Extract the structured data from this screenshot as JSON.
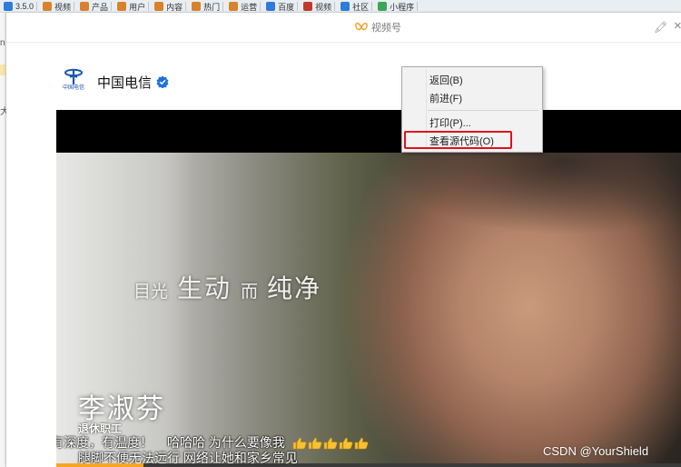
{
  "bookmarks": [
    {
      "label": "3.5.0",
      "color": "#2f7bd9"
    },
    {
      "label": "视频",
      "color": "#d9822b"
    },
    {
      "label": "产品",
      "color": "#d9822b"
    },
    {
      "label": "用户",
      "color": "#d9822b"
    },
    {
      "label": "内容",
      "color": "#d9822b"
    },
    {
      "label": "热门",
      "color": "#d9822b"
    },
    {
      "label": "运营",
      "color": "#d9822b"
    },
    {
      "label": "百度",
      "color": "#2f7bd9"
    },
    {
      "label": "视频",
      "color": "#c0392b"
    },
    {
      "label": "社区",
      "color": "#2f7bd9"
    },
    {
      "label": "小程序",
      "color": "#3aa757"
    }
  ],
  "window": {
    "title": "视频号",
    "pin_icon": "pin-icon",
    "close_icon": "close-icon"
  },
  "account": {
    "name": "中国电信",
    "logo_text": "中国电信",
    "verified_icon": "verified-badge-icon"
  },
  "video": {
    "subtitle": {
      "part1": "目光",
      "part2": "生动",
      "part3": "而",
      "part4": "纯净"
    },
    "person_name": "李淑芬",
    "person_title": "退休职工",
    "danmaku": {
      "line1a": "有深度，有温度！",
      "line1b": "哈哈哈 为什么要像我",
      "line2": "腿脚不便无法远行 网络让她和家乡常见"
    },
    "thumbs_count": 5,
    "progress": 0.14
  },
  "context_menu": {
    "items": [
      "返回(B)",
      "前进(F)",
      "打印(P)...",
      "查看源代码(O)"
    ],
    "highlighted_item": "查看源代码(O)",
    "highlight_color": "#e3101b"
  },
  "watermark": "CSDN @YourShield"
}
